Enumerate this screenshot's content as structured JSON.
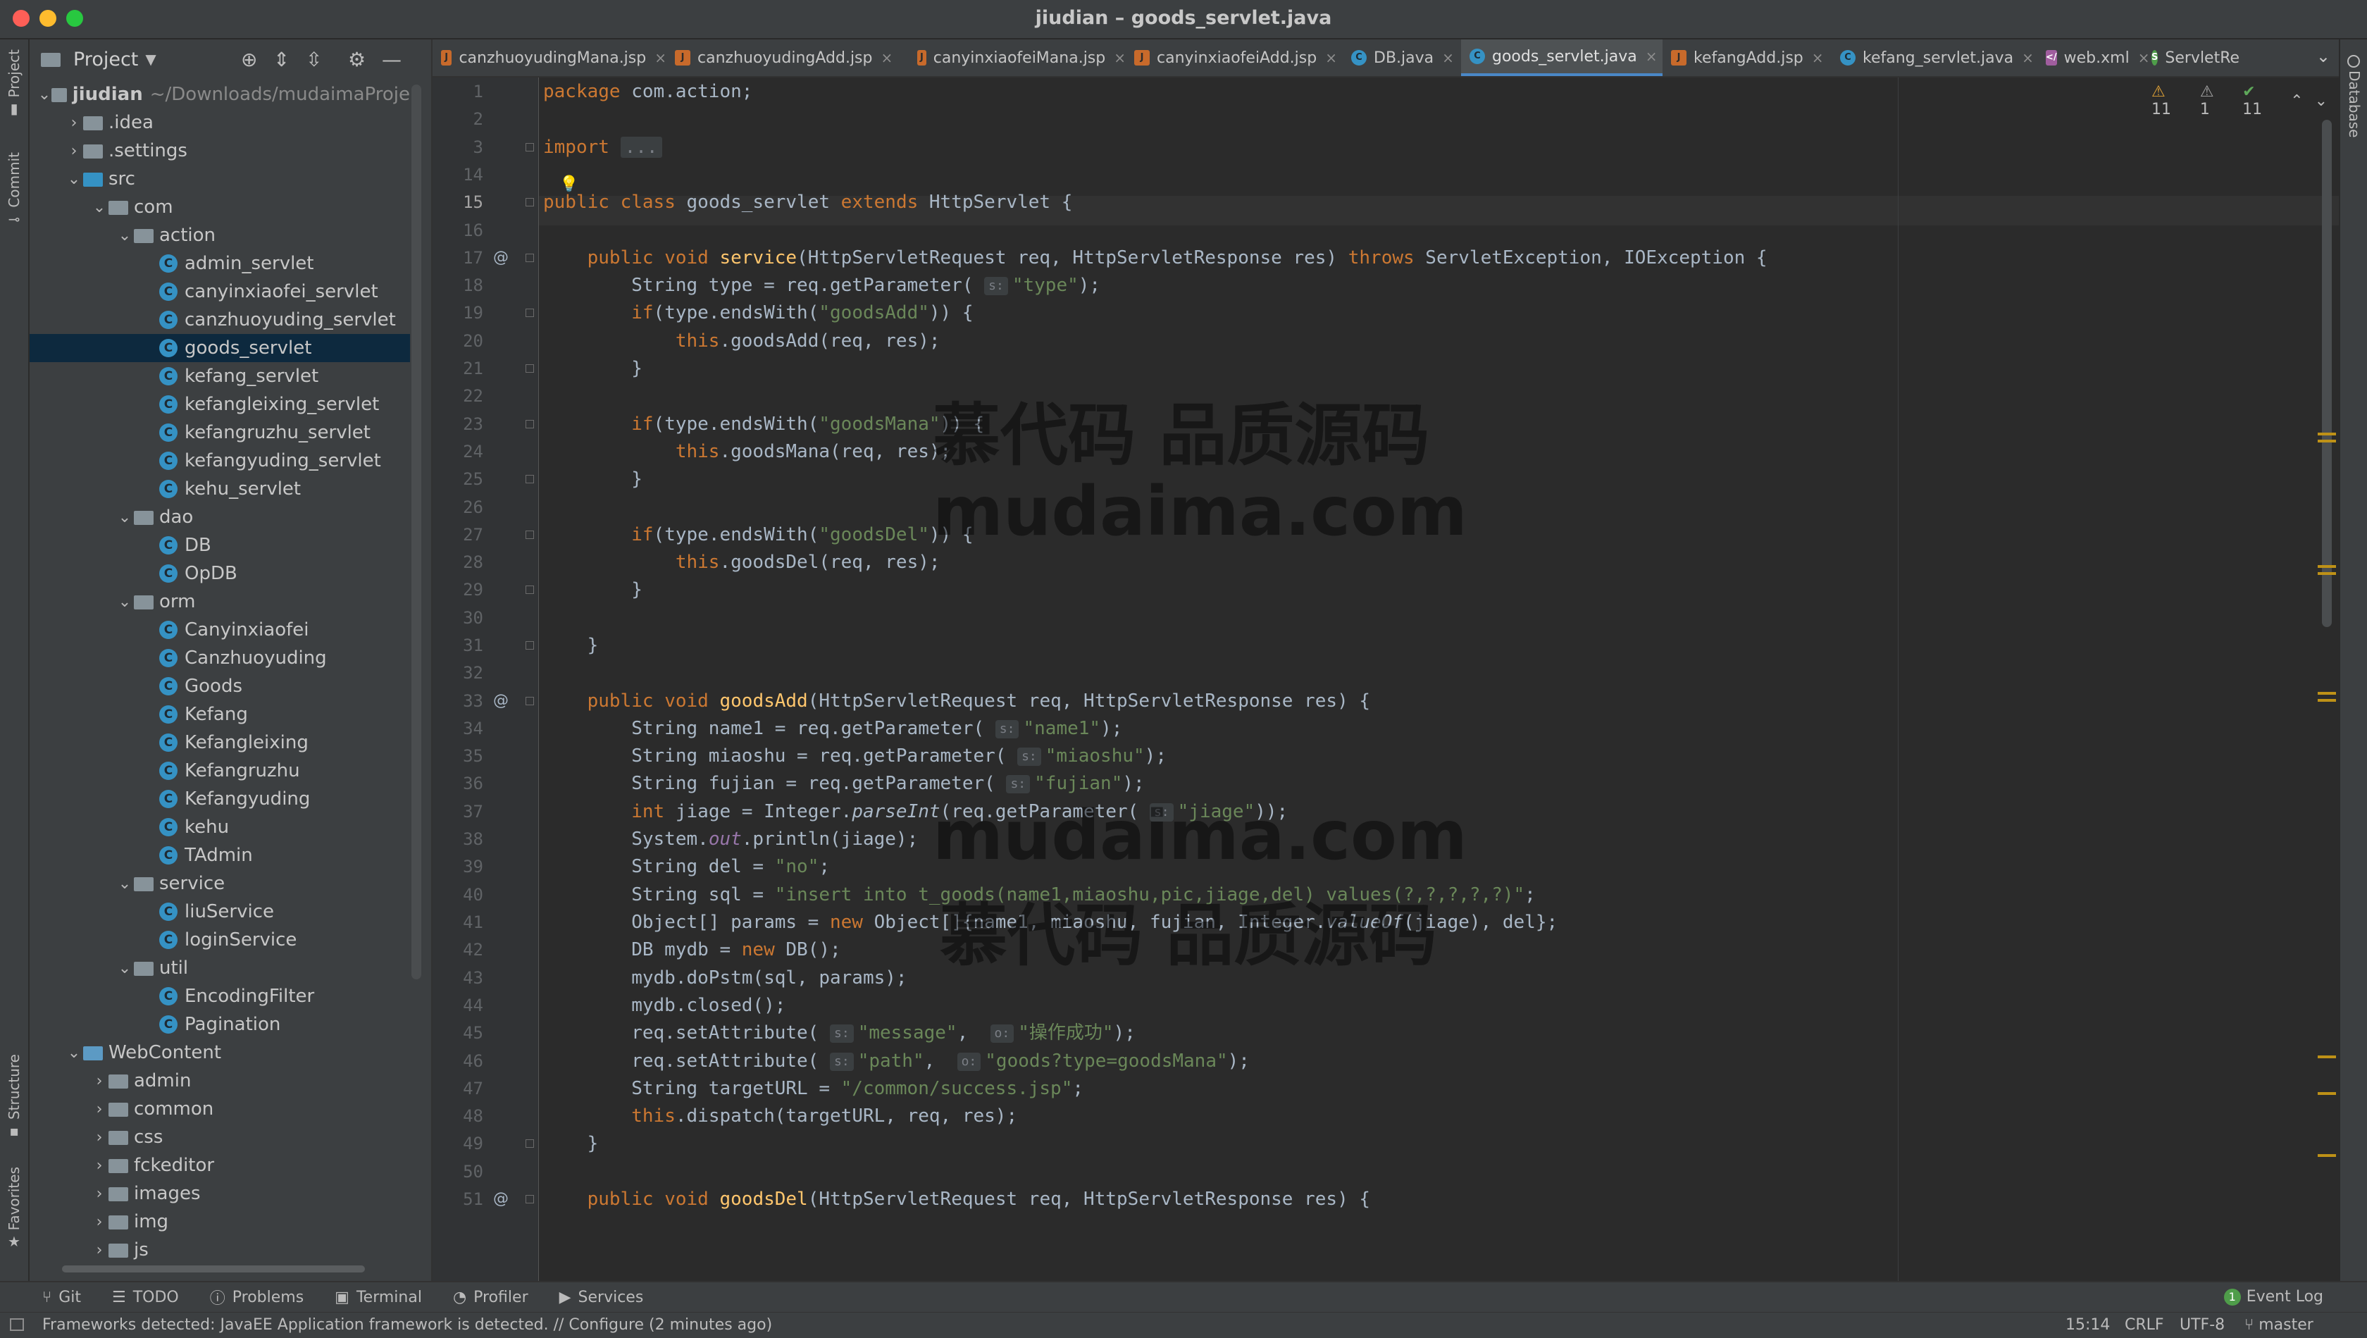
{
  "window": {
    "title": "jiudian – goods_servlet.java"
  },
  "left_strip": {
    "project": "Project",
    "commit": "Commit",
    "structure": "Structure",
    "favorites": "Favorites"
  },
  "right_strip": {
    "database": "Database"
  },
  "project_panel": {
    "title": "Project",
    "tree": [
      {
        "label": "jiudian",
        "extra": "~/Downloads/mudaimaProje",
        "type": "root",
        "depth": 0,
        "expanded": true
      },
      {
        "label": ".idea",
        "type": "folder",
        "depth": 1,
        "expanded": false
      },
      {
        "label": ".settings",
        "type": "folder",
        "depth": 1,
        "expanded": false
      },
      {
        "label": "src",
        "type": "src",
        "depth": 1,
        "expanded": true
      },
      {
        "label": "com",
        "type": "package",
        "depth": 2,
        "expanded": true
      },
      {
        "label": "action",
        "type": "package",
        "depth": 3,
        "expanded": true
      },
      {
        "label": "admin_servlet",
        "type": "class",
        "depth": 4
      },
      {
        "label": "canyinxiaofei_servlet",
        "type": "class",
        "depth": 4
      },
      {
        "label": "canzhuoyuding_servlet",
        "type": "class",
        "depth": 4
      },
      {
        "label": "goods_servlet",
        "type": "class",
        "depth": 4,
        "selected": true
      },
      {
        "label": "kefang_servlet",
        "type": "class",
        "depth": 4
      },
      {
        "label": "kefangleixing_servlet",
        "type": "class",
        "depth": 4
      },
      {
        "label": "kefangruzhu_servlet",
        "type": "class",
        "depth": 4
      },
      {
        "label": "kefangyuding_servlet",
        "type": "class",
        "depth": 4
      },
      {
        "label": "kehu_servlet",
        "type": "class",
        "depth": 4
      },
      {
        "label": "dao",
        "type": "package",
        "depth": 3,
        "expanded": true
      },
      {
        "label": "DB",
        "type": "class",
        "depth": 4
      },
      {
        "label": "OpDB",
        "type": "class",
        "depth": 4
      },
      {
        "label": "orm",
        "type": "package",
        "depth": 3,
        "expanded": true
      },
      {
        "label": "Canyinxiaofei",
        "type": "class",
        "depth": 4
      },
      {
        "label": "Canzhuoyuding",
        "type": "class",
        "depth": 4
      },
      {
        "label": "Goods",
        "type": "class",
        "depth": 4
      },
      {
        "label": "Kefang",
        "type": "class",
        "depth": 4
      },
      {
        "label": "Kefangleixing",
        "type": "class",
        "depth": 4
      },
      {
        "label": "Kefangruzhu",
        "type": "class",
        "depth": 4
      },
      {
        "label": "Kefangyuding",
        "type": "class",
        "depth": 4
      },
      {
        "label": "kehu",
        "type": "class",
        "depth": 4
      },
      {
        "label": "TAdmin",
        "type": "class",
        "depth": 4
      },
      {
        "label": "service",
        "type": "package",
        "depth": 3,
        "expanded": true
      },
      {
        "label": "liuService",
        "type": "class",
        "depth": 4
      },
      {
        "label": "loginService",
        "type": "class",
        "depth": 4
      },
      {
        "label": "util",
        "type": "package",
        "depth": 3,
        "expanded": true
      },
      {
        "label": "EncodingFilter",
        "type": "class",
        "depth": 4
      },
      {
        "label": "Pagination",
        "type": "class",
        "depth": 4
      },
      {
        "label": "WebContent",
        "type": "web",
        "depth": 1,
        "expanded": true
      },
      {
        "label": "admin",
        "type": "folder",
        "depth": 2,
        "expanded": false
      },
      {
        "label": "common",
        "type": "folder",
        "depth": 2,
        "expanded": false
      },
      {
        "label": "css",
        "type": "folder",
        "depth": 2,
        "expanded": false
      },
      {
        "label": "fckeditor",
        "type": "folder",
        "depth": 2,
        "expanded": false
      },
      {
        "label": "images",
        "type": "folder",
        "depth": 2,
        "expanded": false
      },
      {
        "label": "img",
        "type": "folder",
        "depth": 2,
        "expanded": false
      },
      {
        "label": "js",
        "type": "folder",
        "depth": 2,
        "expanded": false
      }
    ]
  },
  "tabs": [
    {
      "label": "canzhuoyudingMana.jsp",
      "kind": "jsp"
    },
    {
      "label": "canzhuoyudingAdd.jsp",
      "kind": "jsp"
    },
    {
      "label": "canyinxiaofeiMana.jsp",
      "kind": "jsp"
    },
    {
      "label": "canyinxiaofeiAdd.jsp",
      "kind": "jsp"
    },
    {
      "label": "DB.java",
      "kind": "java"
    },
    {
      "label": "goods_servlet.java",
      "kind": "java",
      "active": true
    },
    {
      "label": "kefangAdd.jsp",
      "kind": "jsp"
    },
    {
      "label": "kefang_servlet.java",
      "kind": "java"
    },
    {
      "label": "web.xml",
      "kind": "xml"
    },
    {
      "label": "ServletRe",
      "kind": "srv"
    }
  ],
  "inspections": {
    "warnings": "11",
    "weak_warnings": "1",
    "ok": "11"
  },
  "editor": {
    "current_line": "15",
    "lines": [
      {
        "n": "1",
        "t": "package com.action;"
      },
      {
        "n": "2",
        "t": ""
      },
      {
        "n": "3",
        "t": "import ..."
      },
      {
        "n": "14",
        "t": ""
      },
      {
        "n": "15",
        "t": "public class goods_servlet extends HttpServlet {"
      },
      {
        "n": "16",
        "t": ""
      },
      {
        "n": "17",
        "t": "    public void service(HttpServletRequest req, HttpServletResponse res) throws ServletException, IOException {"
      },
      {
        "n": "18",
        "t": "        String type = req.getParameter( s: \"type\");"
      },
      {
        "n": "19",
        "t": "        if(type.endsWith(\"goodsAdd\")) {"
      },
      {
        "n": "20",
        "t": "            this.goodsAdd(req, res);"
      },
      {
        "n": "21",
        "t": "        }"
      },
      {
        "n": "22",
        "t": ""
      },
      {
        "n": "23",
        "t": "        if(type.endsWith(\"goodsMana\")) {"
      },
      {
        "n": "24",
        "t": "            this.goodsMana(req, res);"
      },
      {
        "n": "25",
        "t": "        }"
      },
      {
        "n": "26",
        "t": ""
      },
      {
        "n": "27",
        "t": "        if(type.endsWith(\"goodsDel\")) {"
      },
      {
        "n": "28",
        "t": "            this.goodsDel(req, res);"
      },
      {
        "n": "29",
        "t": "        }"
      },
      {
        "n": "30",
        "t": ""
      },
      {
        "n": "31",
        "t": "    }"
      },
      {
        "n": "32",
        "t": ""
      },
      {
        "n": "33",
        "t": "    public void goodsAdd(HttpServletRequest req, HttpServletResponse res) {"
      },
      {
        "n": "34",
        "t": "        String name1 = req.getParameter( s: \"name1\");"
      },
      {
        "n": "35",
        "t": "        String miaoshu = req.getParameter( s: \"miaoshu\");"
      },
      {
        "n": "36",
        "t": "        String fujian = req.getParameter( s: \"fujian\");"
      },
      {
        "n": "37",
        "t": "        int jiage = Integer.parseInt(req.getParameter( s: \"jiage\"));"
      },
      {
        "n": "38",
        "t": "        System.out.println(jiage);"
      },
      {
        "n": "39",
        "t": "        String del = \"no\";"
      },
      {
        "n": "40",
        "t": "        String sql = \"insert into t_goods(name1,miaoshu,pic,jiage,del) values(?,?,?,?,?)\";"
      },
      {
        "n": "41",
        "t": "        Object[] params = new Object[]{name1, miaoshu, fujian, Integer.valueOf(jiage), del};"
      },
      {
        "n": "42",
        "t": "        DB mydb = new DB();"
      },
      {
        "n": "43",
        "t": "        mydb.doPstm(sql, params);"
      },
      {
        "n": "44",
        "t": "        mydb.closed();"
      },
      {
        "n": "45",
        "t": "        req.setAttribute( s: \"message\",  o: \"操作成功\");"
      },
      {
        "n": "46",
        "t": "        req.setAttribute( s: \"path\",  o: \"goods?type=goodsMana\");"
      },
      {
        "n": "47",
        "t": "        String targetURL = \"/common/success.jsp\";"
      },
      {
        "n": "48",
        "t": "        this.dispatch(targetURL, req, res);"
      },
      {
        "n": "49",
        "t": "    }"
      },
      {
        "n": "50",
        "t": ""
      },
      {
        "n": "51",
        "t": "    public void goodsDel(HttpServletRequest req, HttpServletResponse res) {"
      }
    ]
  },
  "watermarks": [
    "慕代码 品质源码",
    "mudaima.com",
    "mudaima.com",
    "慕代码 品质源码"
  ],
  "tool_windows": {
    "git": "Git",
    "todo": "TODO",
    "problems": "Problems",
    "terminal": "Terminal",
    "profiler": "Profiler",
    "services": "Services",
    "event_log": "Event Log",
    "event_count": "1"
  },
  "status": {
    "message": "Frameworks detected: JavaEE Application framework is detected. // Configure (2 minutes ago)",
    "position": "15:14",
    "line_sep": "CRLF",
    "encoding": "UTF-8",
    "branch": "master"
  }
}
